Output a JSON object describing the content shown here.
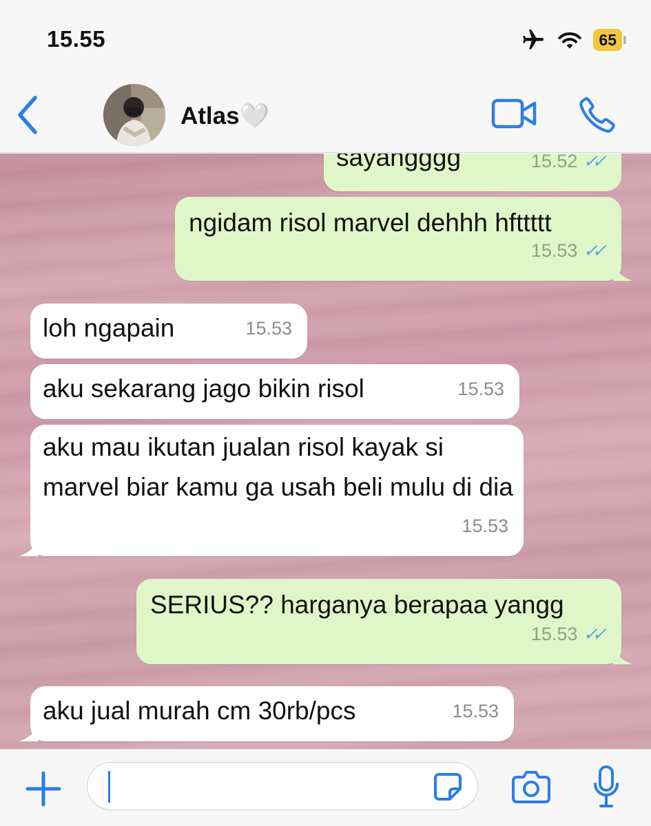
{
  "status_bar": {
    "time": "15.55",
    "battery": "65"
  },
  "header": {
    "contact_name": "Atlas🤍"
  },
  "messages": [
    {
      "dir": "out",
      "text": "sayangggg",
      "time": "15.52"
    },
    {
      "dir": "out",
      "text": "ngidam risol marvel dehhh hfttttt",
      "time": "15.53"
    },
    {
      "dir": "in",
      "text": "loh ngapain",
      "time": "15.53"
    },
    {
      "dir": "in",
      "text": "aku sekarang jago bikin risol",
      "time": "15.53"
    },
    {
      "dir": "in",
      "text": "aku mau ikutan jualan risol kayak si marvel biar kamu ga usah beli mulu di dia",
      "time": "15.53"
    },
    {
      "dir": "out",
      "text": "SERIUS?? harganya berapaa yangg",
      "time": "15.53"
    },
    {
      "dir": "in",
      "text": "aku jual murah cm 30rb/pcs",
      "time": "15.53"
    }
  ],
  "colors": {
    "accent": "#2b7de9",
    "outgoing_bubble": "#dff7c8",
    "incoming_bubble": "#ffffff",
    "read_ticks": "#5aa8e8",
    "battery": "#f3c73c"
  },
  "icons": [
    "airplane-icon",
    "wifi-icon",
    "back-chevron-icon",
    "video-call-icon",
    "phone-icon",
    "plus-icon",
    "sticker-icon",
    "camera-icon",
    "microphone-icon"
  ]
}
